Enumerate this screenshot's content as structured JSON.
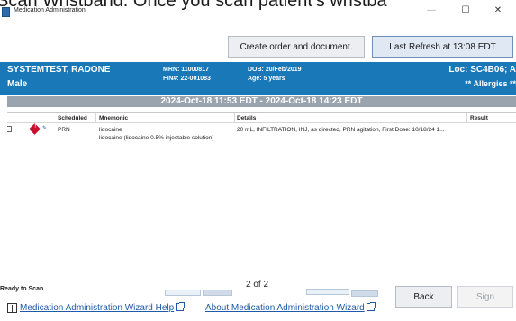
{
  "overlay": {
    "text": "Scan Wristband. Once you scan patient's wristba"
  },
  "window": {
    "title": "Medication Administration",
    "controls": {
      "minimize": "—",
      "maximize": "☐",
      "close": "✕"
    }
  },
  "toolbar": {
    "create_label": "Create order and document.",
    "refresh_label": "Last Refresh at 13:08 EDT"
  },
  "patient": {
    "name": "SYSTEMTEST, RADONE",
    "gender": "Male",
    "mrn": "MRN: 11000817",
    "fin": "FIN#: 22-001083",
    "dob": "DOB: 20/Feb/2019",
    "age": "Age: 5 years",
    "location": "Loc: SC4B06; A",
    "allergies": "** Allergies **"
  },
  "time_range": "2024-Oct-18 11:53 EDT - 2024-Oct-18 14:23 EDT",
  "table": {
    "headers": [
      "Scheduled",
      "Mnemonic",
      "Details",
      "Result"
    ],
    "rows": [
      {
        "scheduled": "PRN",
        "mnemonic": "lidocaine",
        "mnemonic_sub": "lidocaine (lidocaine 0.5% injectable solution)",
        "details": "20 mL, INFILTRATION, INJ, as directed, PRN agitation, First Dose: 10/18/24 1...",
        "result": "",
        "alert_icon": "exclamation-diamond-icon",
        "med_icon": "syringe-icon"
      }
    ]
  },
  "status": "Ready to Scan",
  "pagination": "2 of 2",
  "actions": {
    "back_label": "Back",
    "sign_label": "Sign"
  },
  "footer": {
    "link_wizard": "Medication Administration Wizard Help",
    "link_about": "About Medication Administration Wizard"
  }
}
